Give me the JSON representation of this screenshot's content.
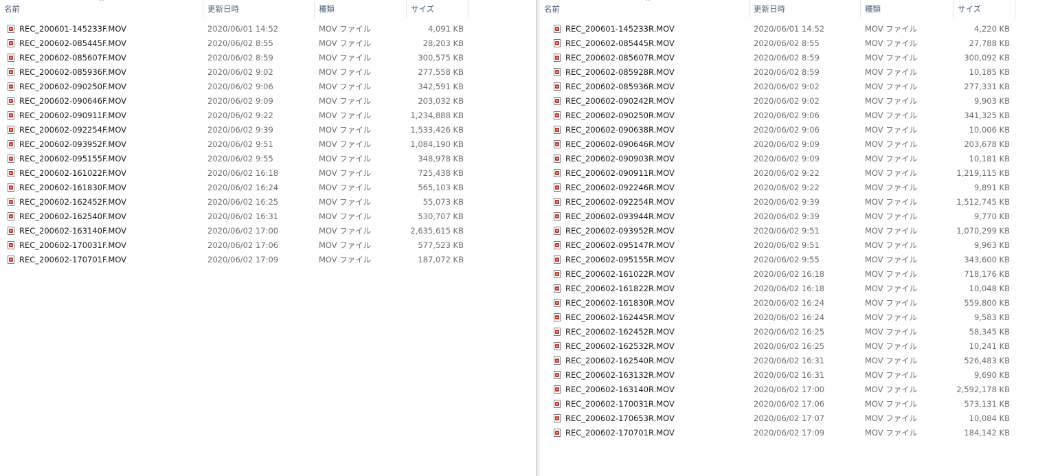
{
  "columns": {
    "name": "名前",
    "date": "更新日時",
    "type": "種類",
    "size": "サイズ"
  },
  "sort_indicator": "^",
  "left_files": [
    {
      "name": "REC_200601-145233F.MOV",
      "date": "2020/06/01 14:52",
      "type": "MOV ファイル",
      "size": "4,091 KB"
    },
    {
      "name": "REC_200602-085445F.MOV",
      "date": "2020/06/02 8:55",
      "type": "MOV ファイル",
      "size": "28,203 KB"
    },
    {
      "name": "REC_200602-085607F.MOV",
      "date": "2020/06/02 8:59",
      "type": "MOV ファイル",
      "size": "300,575 KB"
    },
    {
      "name": "REC_200602-085936F.MOV",
      "date": "2020/06/02 9:02",
      "type": "MOV ファイル",
      "size": "277,558 KB"
    },
    {
      "name": "REC_200602-090250F.MOV",
      "date": "2020/06/02 9:06",
      "type": "MOV ファイル",
      "size": "342,591 KB"
    },
    {
      "name": "REC_200602-090646F.MOV",
      "date": "2020/06/02 9:09",
      "type": "MOV ファイル",
      "size": "203,032 KB"
    },
    {
      "name": "REC_200602-090911F.MOV",
      "date": "2020/06/02 9:22",
      "type": "MOV ファイル",
      "size": "1,234,888 KB"
    },
    {
      "name": "REC_200602-092254F.MOV",
      "date": "2020/06/02 9:39",
      "type": "MOV ファイル",
      "size": "1,533,426 KB"
    },
    {
      "name": "REC_200602-093952F.MOV",
      "date": "2020/06/02 9:51",
      "type": "MOV ファイル",
      "size": "1,084,190 KB"
    },
    {
      "name": "REC_200602-095155F.MOV",
      "date": "2020/06/02 9:55",
      "type": "MOV ファイル",
      "size": "348,978 KB"
    },
    {
      "name": "REC_200602-161022F.MOV",
      "date": "2020/06/02 16:18",
      "type": "MOV ファイル",
      "size": "725,438 KB"
    },
    {
      "name": "REC_200602-161830F.MOV",
      "date": "2020/06/02 16:24",
      "type": "MOV ファイル",
      "size": "565,103 KB"
    },
    {
      "name": "REC_200602-162452F.MOV",
      "date": "2020/06/02 16:25",
      "type": "MOV ファイル",
      "size": "55,073 KB"
    },
    {
      "name": "REC_200602-162540F.MOV",
      "date": "2020/06/02 16:31",
      "type": "MOV ファイル",
      "size": "530,707 KB"
    },
    {
      "name": "REC_200602-163140F.MOV",
      "date": "2020/06/02 17:00",
      "type": "MOV ファイル",
      "size": "2,635,615 KB"
    },
    {
      "name": "REC_200602-170031F.MOV",
      "date": "2020/06/02 17:06",
      "type": "MOV ファイル",
      "size": "577,523 KB"
    },
    {
      "name": "REC_200602-170701F.MOV",
      "date": "2020/06/02 17:09",
      "type": "MOV ファイル",
      "size": "187,072 KB"
    }
  ],
  "right_files": [
    {
      "name": "REC_200601-145233R.MOV",
      "date": "2020/06/01 14:52",
      "type": "MOV ファイル",
      "size": "4,220 KB"
    },
    {
      "name": "REC_200602-085445R.MOV",
      "date": "2020/06/02 8:55",
      "type": "MOV ファイル",
      "size": "27,788 KB"
    },
    {
      "name": "REC_200602-085607R.MOV",
      "date": "2020/06/02 8:59",
      "type": "MOV ファイル",
      "size": "300,092 KB"
    },
    {
      "name": "REC_200602-085928R.MOV",
      "date": "2020/06/02 8:59",
      "type": "MOV ファイル",
      "size": "10,185 KB"
    },
    {
      "name": "REC_200602-085936R.MOV",
      "date": "2020/06/02 9:02",
      "type": "MOV ファイル",
      "size": "277,331 KB"
    },
    {
      "name": "REC_200602-090242R.MOV",
      "date": "2020/06/02 9:02",
      "type": "MOV ファイル",
      "size": "9,903 KB"
    },
    {
      "name": "REC_200602-090250R.MOV",
      "date": "2020/06/02 9:06",
      "type": "MOV ファイル",
      "size": "341,325 KB"
    },
    {
      "name": "REC_200602-090638R.MOV",
      "date": "2020/06/02 9:06",
      "type": "MOV ファイル",
      "size": "10,006 KB"
    },
    {
      "name": "REC_200602-090646R.MOV",
      "date": "2020/06/02 9:09",
      "type": "MOV ファイル",
      "size": "203,678 KB"
    },
    {
      "name": "REC_200602-090903R.MOV",
      "date": "2020/06/02 9:09",
      "type": "MOV ファイル",
      "size": "10,181 KB"
    },
    {
      "name": "REC_200602-090911R.MOV",
      "date": "2020/06/02 9:22",
      "type": "MOV ファイル",
      "size": "1,219,115 KB"
    },
    {
      "name": "REC_200602-092246R.MOV",
      "date": "2020/06/02 9:22",
      "type": "MOV ファイル",
      "size": "9,891 KB"
    },
    {
      "name": "REC_200602-092254R.MOV",
      "date": "2020/06/02 9:39",
      "type": "MOV ファイル",
      "size": "1,512,745 KB"
    },
    {
      "name": "REC_200602-093944R.MOV",
      "date": "2020/06/02 9:39",
      "type": "MOV ファイル",
      "size": "9,770 KB"
    },
    {
      "name": "REC_200602-093952R.MOV",
      "date": "2020/06/02 9:51",
      "type": "MOV ファイル",
      "size": "1,070,299 KB"
    },
    {
      "name": "REC_200602-095147R.MOV",
      "date": "2020/06/02 9:51",
      "type": "MOV ファイル",
      "size": "9,963 KB"
    },
    {
      "name": "REC_200602-095155R.MOV",
      "date": "2020/06/02 9:55",
      "type": "MOV ファイル",
      "size": "343,600 KB"
    },
    {
      "name": "REC_200602-161022R.MOV",
      "date": "2020/06/02 16:18",
      "type": "MOV ファイル",
      "size": "718,176 KB"
    },
    {
      "name": "REC_200602-161822R.MOV",
      "date": "2020/06/02 16:18",
      "type": "MOV ファイル",
      "size": "10,048 KB"
    },
    {
      "name": "REC_200602-161830R.MOV",
      "date": "2020/06/02 16:24",
      "type": "MOV ファイル",
      "size": "559,800 KB"
    },
    {
      "name": "REC_200602-162445R.MOV",
      "date": "2020/06/02 16:24",
      "type": "MOV ファイル",
      "size": "9,583 KB"
    },
    {
      "name": "REC_200602-162452R.MOV",
      "date": "2020/06/02 16:25",
      "type": "MOV ファイル",
      "size": "58,345 KB"
    },
    {
      "name": "REC_200602-162532R.MOV",
      "date": "2020/06/02 16:25",
      "type": "MOV ファイル",
      "size": "10,241 KB"
    },
    {
      "name": "REC_200602-162540R.MOV",
      "date": "2020/06/02 16:31",
      "type": "MOV ファイル",
      "size": "526,483 KB"
    },
    {
      "name": "REC_200602-163132R.MOV",
      "date": "2020/06/02 16:31",
      "type": "MOV ファイル",
      "size": "9,690 KB"
    },
    {
      "name": "REC_200602-163140R.MOV",
      "date": "2020/06/02 17:00",
      "type": "MOV ファイル",
      "size": "2,592,178 KB"
    },
    {
      "name": "REC_200602-170031R.MOV",
      "date": "2020/06/02 17:06",
      "type": "MOV ファイル",
      "size": "573,131 KB"
    },
    {
      "name": "REC_200602-170653R.MOV",
      "date": "2020/06/02 17:07",
      "type": "MOV ファイル",
      "size": "10,084 KB"
    },
    {
      "name": "REC_200602-170701R.MOV",
      "date": "2020/06/02 17:09",
      "type": "MOV ファイル",
      "size": "184,142 KB"
    }
  ]
}
